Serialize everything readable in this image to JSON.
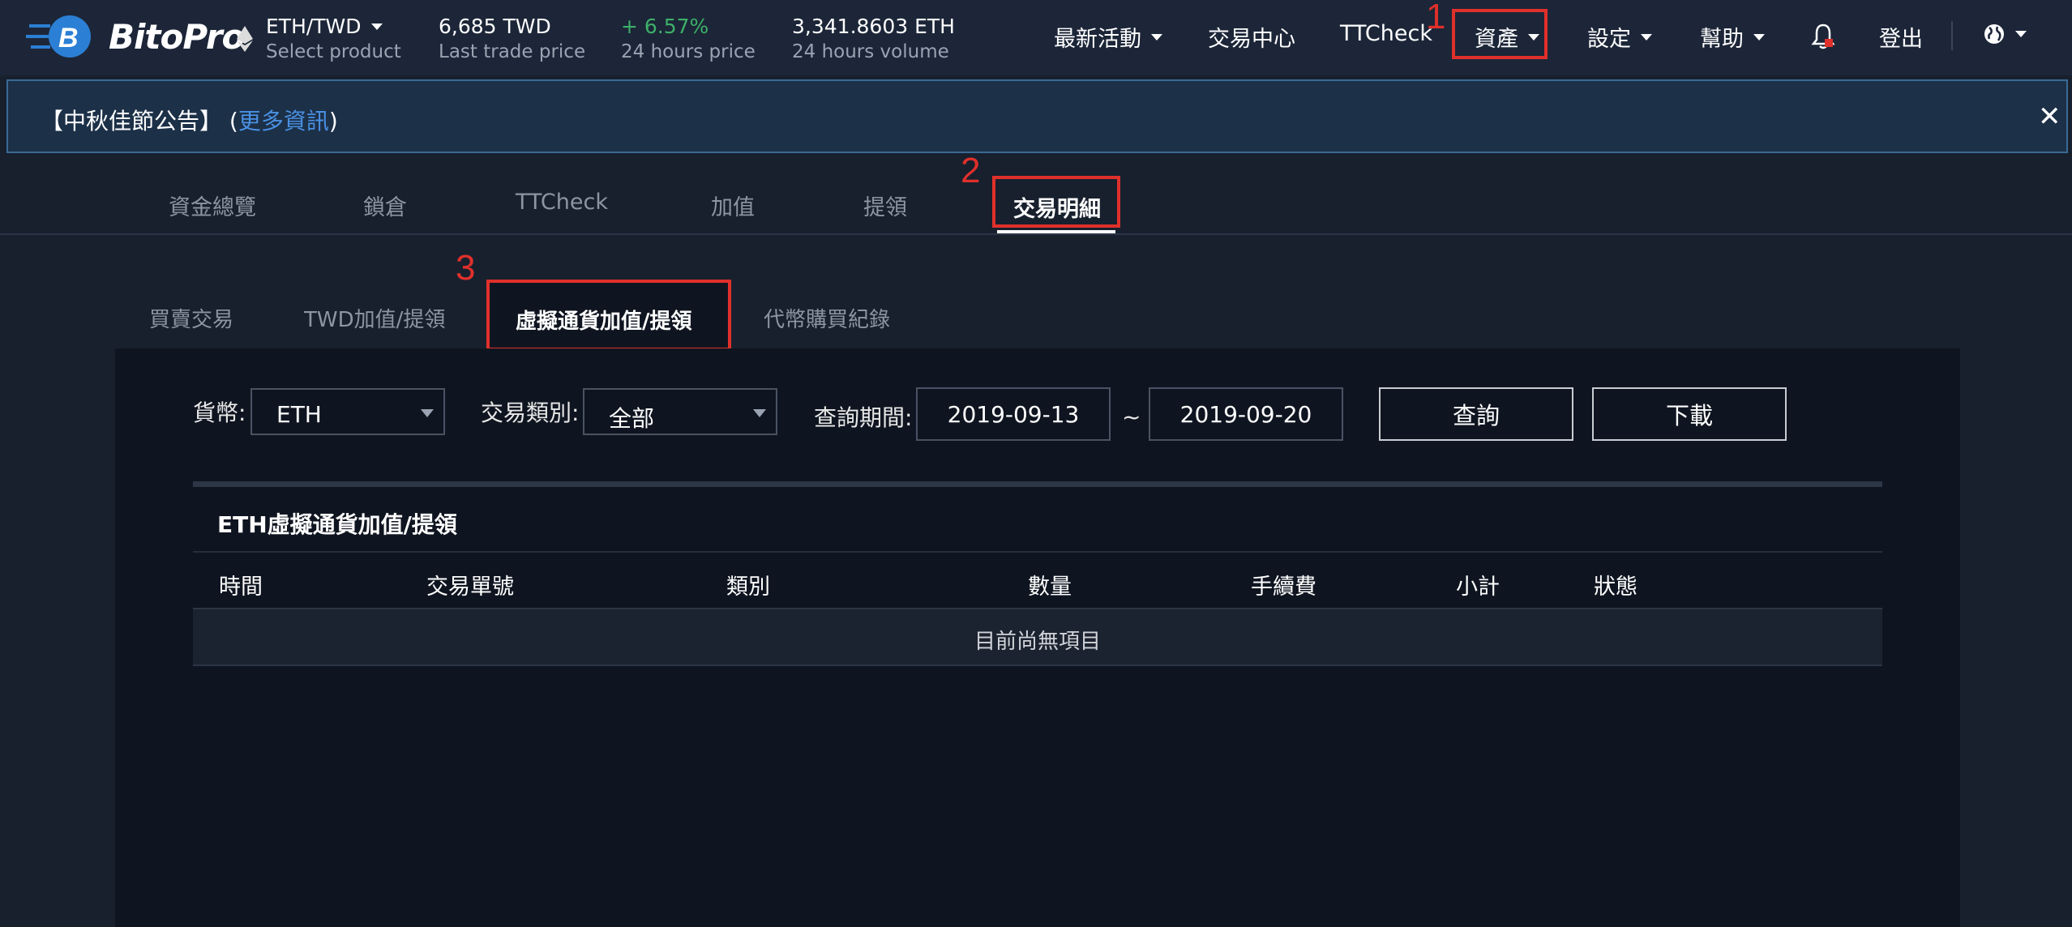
{
  "brand": {
    "name": "BitoPro",
    "logo_icon": "bitopro-logo-icon"
  },
  "product": {
    "pair": "ETH/TWD",
    "hint": "Select product",
    "icon": "ethereum-icon"
  },
  "stats": [
    {
      "value": "6,685 TWD",
      "label": "Last trade price"
    },
    {
      "value": "+ 6.57%",
      "label": "24 hours price"
    },
    {
      "value": "3,341.8603 ETH",
      "label": "24 hours volume"
    }
  ],
  "colors": {
    "positive": "#3db068",
    "link": "#4a90e2",
    "highlight": "#e0302b"
  },
  "nav": {
    "latest": "最新活動",
    "exchange": "交易中心",
    "ttcheck": "TTCheck",
    "assets": "資產",
    "settings": "設定",
    "help": "幫助",
    "logout": "登出",
    "notification_icon": "bell-icon",
    "language_icon": "globe-icon"
  },
  "annotations": [
    "1",
    "2",
    "3"
  ],
  "announcement": {
    "prefix": "【中秋佳節公告】 (",
    "link": "更多資訊",
    "suffix": ")",
    "close": "✕"
  },
  "main_tabs": [
    "資金總覽",
    "鎖倉",
    "TTCheck",
    "加值",
    "提領",
    "交易明細"
  ],
  "sub_tabs": [
    "買賣交易",
    "TWD加值/提領",
    "虛擬通貨加值/提領",
    "代幣購買紀錄"
  ],
  "filters": {
    "currency_label": "貨幣:",
    "currency_value": "ETH",
    "type_label": "交易類別:",
    "type_value": "全部",
    "period_label": "查詢期間:",
    "date_from": "2019-09-13",
    "date_sep": "~",
    "date_to": "2019-09-20",
    "query_button": "查詢",
    "download_button": "下載"
  },
  "table": {
    "title": "ETH虛擬通貨加值/提領",
    "columns": [
      "時間",
      "交易單號",
      "類別",
      "數量",
      "手續費",
      "小計",
      "狀態"
    ],
    "empty_text": "目前尚無項目"
  }
}
